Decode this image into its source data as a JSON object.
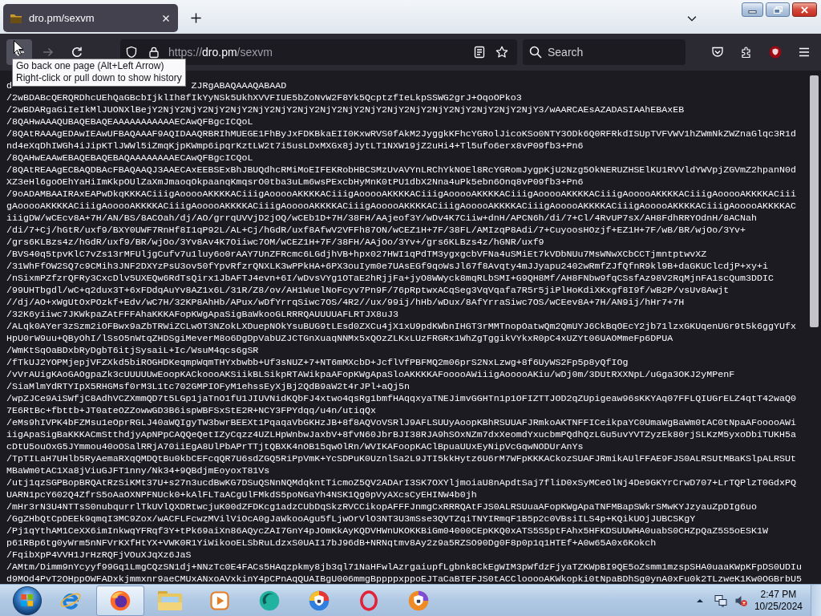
{
  "browser": {
    "tabs": [
      {
        "title": "dro.pm/sexvm",
        "selected": true
      }
    ],
    "navigation": {
      "back": {
        "disabled": false
      },
      "forward": {
        "disabled": true
      }
    },
    "address": {
      "scheme": "https://",
      "host": "dro.pm",
      "path": "/sexvm"
    },
    "search": {
      "placeholder": "Search"
    },
    "tooltip": {
      "lines": [
        "Go back one page (Alt+Left Arrow)",
        "Right-click or pull down to show history"
      ]
    }
  },
  "page": {
    "cut_line": {
      "start": "d",
      "end": "ZJRgABAQAAAQABAAD"
    },
    "lines": [
      "/2wBDABcQERQRDhcUEhQaGBcbIjklIh8fIkYyNSk5UkhXVVFIUE5bZoNvW2F8Yk5QcptzfIeLkpSSWG2grJ+OqoOPko3",
      "/2wBDARgaGiIeIkMlJUONXlBejY2NjY2NjY2NjY2NjY2NjY2NjY2NjY2NjY2NjY2NjY2NjY2NjY2NjY2NjY2NjY2NjY2NjY3/wAARCAEsAZADASIAAhEBAxEB",
      "/8QAHwAAAQUBAQEBAQEAAAAAAAAAAAECAwQFBgcICQoL",
      "/8QAtRAAAgEDAwIEAwUFBAQAAAF9AQIDAAQRBRIhMUEGE1FhByJxFDKBkaEII0KxwRVS0fAkM2JyggkKFhcYGRolJicoKSo0NTY3ODk6Q0RFRkdISUpTVFVWV1hZWmNkZWZnaGlqc3R1d",
      "nd4eXqDhIWGh4iJipKTlJWWl5iZmqKjpKWmp6ipqrKztLW2t7i5usLDxMXGx8jJytLT1NXW19jZ2uHi4+Tl5ufo6erx8vP09fb3+Pn6",
      "/8QAHwEAAwEBAQEBAQEBAQAAAAAAAAECAwQFBgcICQoL",
      "/8QAtREAAgECBAQDBAcFBAQAAQJ3AAECAxEEBSExBhJBUQdhcRMiMoEIFEKRobHBCSMzUvAVYnLRChYkNOEl8RcYGRomJygpKjU2Nzg5OkNERUZHSElKU1RVVldYWVpjZGVmZ2hpanN0d",
      "XZ3eHl6goOEhYaHiImKkpOUlZaXmJmaoqOkpaanqKmqsrO0tba3uLm6wsPExcbHyMnK0tPU1dbX2Nna4uPk5ebn6Onq8vP09fb3+Pn6",
      "/9oADAMBAAIRAxEAPwDkqKKKACiiigAooooAKKKKACiiigAooooAKKKKACiiigAooooAKKKKACiiigAooooAKKKKACiiigAooooAKKKKACiiigAooooAKKKKACiiigAooooAKKKKACiii",
      "gAooooAKKKKACiiigAooooAKKKKACiiigAooooAKKKKACiiigAooooAKKKKACiiigAooooAKKKKACiiigAooooAKKKKACiiigAooooAKKKKACiiigAooooAKKKKACiiigAooooAKKKKAC",
      "iiigDW/wCEcv8A+7H/AN/BS/8ACOah/dj/AO/grrqUVVjD2jOQ/wCEb1D+7H/38FH/AAjeof3Y/wDv4K7Ciiw+dnH/APCN6h/di/7+Cl/4RvUP7sX/AH8FdhRRYOdnH/8ACNah",
      "/di/7+Cj/hGtR/uxf9/BXY0UWF7RnHf8I1qP92L/AL+Cj/hGdR/uxf8AfwV2VFFh87ON/wCEZ1H+7F/38FL/AMIzqP8Adi/7+CuyoosHOzjf+EZ1H+7F/wB/BR/wjOo/3Yv+",
      "/grs6KLBzs4z/hGdR/uxf9/BR/wjOo/3Yv8Av4K7Oiiwc7OM/wCEZ1H+7F/38FH/AAjOo/3Yv+/grs6KLBzs4z/hGNR/uxf9",
      "/BVS40q5tpvKlC7vZs13rMFUljgCufv7u1luy6o0rAAY7UnZFRcmc6LGdjhVB+hpx027HWI1qPdTM3ygxgcbVFNa4uSMiEt7kVDbNUu7MsWNwXCbCCTjmntptwvXZ",
      "/31WhFfOW2SQ7c9CMih3JNF2DXYzPsU3ov50fYpvRfzrQNXLK3wPPkHA+6PX3ouIym0e7UAsEGf9qoWsJl67f8Avqty4mJJyapu2402wRmfZJfQfnR9kl9B+daGKUClcdjP+xy+i",
      "/nSixmPZfzrQFRy3CxcDlv5UXEQw6RdTsQirx1JbAFTJ4evn+6I/wDvsVYg1OTaE2hRjjFa+jyO8WWyck8mqRLbSMI+G9QH8Mf/AH8FNbw9fqCSsfAz98V2RqMjnFA1scQum3DDIC",
      "/99UHTbgdl/wC+q2dux3T+6xFDdqAuYv8AZ1x6L/31R/Z8/ov/AH1WuelNoFcyv7Pn9F/76pRptwxACqSeg3VqVqafa7R5r5jiPlHoKdiXKxgf8I9f/wB2P/vsUv8Awjt",
      "//dj/AO+xWgUtOxPOzkf+Edv/wC7H/32KP8AhHb/APux/wDfYrrqSiwc7OS/4R2//ux/99ij/hHb/wDux/8AfYrraSiwc7OS/wCEev8A+7H/AN9ij/hHr7+7H",
      "/32K6yiiwc7JKWkpaZAtFFFAhaKKKAFopKWgApaSigBaWkooGLRRRQAUUUUAFLRTJX8uJ3",
      "/ALqk0AYer3zSzm2iOFBwx9aZbTRWiZCLwOT3NZokLXDuepNOkYsuBUG9tLEsd0ZXCu4jX1xU9pdKWbnIHGT3rMMTnopOatwQm2QmUYJ6CkBqOEcY2jb71lzxGKUqenUGr9t5k6ggYUfx",
      "HpU0rW9uu+QByOhI/lSsO5nWtqZHDSgiMeverM8o6DgDpVabUZJCTGnXuaqNNMx5xQOzZLKxLUzFRGRx1WhZgTggikVYkxR0pC4xUZYt06UAOMmeFp6DPUA",
      "/WmKtSqOaBDxbRyDgbT6itjSysaiL+Ic/WsuM4qcs6gSR",
      "/fTkUJ2YOPMjepjVFZXkd5biROGHDKeqmpWqmTHYxbwbb+Uf3sNUZ+7+NT6mMXcbD+JcflVfPBFMQ2m06prS2NxLzwg+8f6UyWS2Fp5p8yQfIOg",
      "/vVrAUigKAoGAOgpaZk3cUUUUUwEoopKACkoooAKSiikBLSikpRTAWikpaAFopKWgApaSloAKKKKAFooooAWiiigAooooAKiu/wDj0m/3DUtRXXNpL/uGga3OKJ2yMPenF",
      "/SiaMlmYdRTYIpX5RHGMsf0rM3L1tc702GMPIOFyM1ehssEyXjBj2QdB9aW2t4rJPl+aQj5n",
      "/wpZJCe9AiSWfjC8AdhVCZXmmQD7t5LGp1jaTnO1fU1JIUVNidKQbFJ4xtwo4qsRg1bmfHAqqxyaTNEJimvGGHTn1p1OFIZTTJOD2qZUpigeaw96sKKYAq07FFLQIUGrELZ4qtT42waQ0",
      "7E6RtBc+fbttb+JT0ateOZZowwGD3B6ispWBFSxStE2R+NCY3FPYdqq/u4n/utiqQx",
      "/eMs9hIVPK4bFZMsu1eOprRGLJ40aWQIgyTW3bwrBEEXt1PqaqaVbGKHzJB+8f8AQVoVSRlJ9AFLSUUyAoopKBhRSUUAFJRmkoAKTNFFICeikpaYC0UmaWgBaWm0tAC0tNpaAFooooAWi",
      "iigApaSigBaKKKACmStthdjyApNPpCAQQeQetIZyCqzz4UZLHpWnbwJaxbV+8fvN60JbrBJI38RJA9hSOxNZm7dxXeomdYxucbmPQdhQzLGu5uvYVTZyzEk80rjSLKzM5yxoDbiTUKH5a",
      "cDtU5ouOxG5JYmmou40oOSalRRjA70iiEgA8UlPbAPrTTjtQBXK4nOB15qwOlRn/WVIKAFoopKAClBpuaUUxEyNipVcGqwNODUrAnYs",
      "/TpTILaH7UHlb5RyAemaRXqQMDQtBu0kbCEFcqQR7U6sdZGQ5RiPpVmK+YcSDPuK0UznlSa2L9JTI5kkHytz6U6rM7WFpKKKACkozSUAFJRmikAUlFFAE9FJS0ALRSUtMBaKSlpALRSUt",
      "MBaWm0tAC1Xa8jViuGJFT1nny/Nk34+9QBdjmEoyoxT81Vs",
      "/utj1qzSGPBopBRQAtRzSiKMt37U+s27n3ucdBwKG7DSuQSNnNQMdqkntTicmoZ5QV2ADArI3SK7OXYljmoiaU8nApdtSaj7fliD0xSyMCeOlNj4De9GKYrCrwD707+LrTQPlzT0GdxPQ",
      "UARN1pcY602Q4ZfrS5oAaOXNPFNUck0+kAlFLTaACgUlFMkdS5poNGaYh4NSK1Qg0pVyAXcsCyEHINW4b0jh",
      "/mHr3rN3U4NTTsS0nubqurrlTkUVlQXDRtwcjuK00dZFDKcg1adzCUbDqSkzRVCCikopAFFFJnmgCxRRRQAtFJS0ALRSUuaAFopKWgApaTNFMBapSWkrSMwKYJzyauZpDIg6uo",
      "/GgZHbQtCpDEEk9qmqI3MC9Zox/wACFLFcwzMVilViOcA0gJaWkooAgu5fLjwOrVlO3NT3U3mSse3QVTZqiTNYIRmqF1B5p2c0VBsiILS4p+KQikUOjJUBCSKgY",
      "/Pj1qYthAM1CeXX6imInkwqYFRqf3Y+tPk69aiXn86AQycZAI7GnY4pJOmKkAyKQDVHWnUKOKKBiGm04000CEpKKQ0xATS5S5ptFAhx5HFKDSUUWHA0uabS0CHZpQaZ5S5oESK1W",
      "p61RBp6tg0yWrm5nNFVrKXfHtYX+VWK0R1YiWikooELSbRuLdzxS0UAI17bJ96dB+NRNqtmv8Ay2z9a5RZSO90Dg0F8p0p1q1HTEf+A0w65A0x6Kokch",
      "/FqibXpP4VVH1JrHzRQFjVOuXJqXz6JaS",
      "/AMtm/Dimm9nYcyyf99Gq1LmgCQzSN1dj+NNzTc0E4FACs5HAqzpkmy8jb3ql71NaHFwlAzrgaiupfLgbnk8CkEgWIM3pWfdzFjyaTZKWpBI9QE5oZsmm1mzspSHA0uaaKWpKFpDS0UDIu",
      "d9MOd4PvT2OHppOWFADxkjmmxnr9aeCMUxANxoAVxkinY4pCPnAqQUAIBgU006mmgBppppxppoEJTaCaBTEFJS0tACClooooAKWkopki0tNpaBDhSg0ynA0xFu0k2TLzweK1Kw0OGBrbU5"
    ]
  },
  "taskbar": {
    "apps": [
      {
        "kind": "ie",
        "selected": false
      },
      {
        "kind": "firefox",
        "selected": true
      },
      {
        "kind": "folder",
        "selected": false
      },
      {
        "kind": "player",
        "selected": false
      },
      {
        "kind": "bubble",
        "selected": false
      },
      {
        "kind": "lockblue",
        "selected": false
      },
      {
        "kind": "opera",
        "selected": false
      },
      {
        "kind": "lockorange",
        "selected": false
      }
    ],
    "tray": {
      "volume_muted": true
    },
    "clock": {
      "time": "2:47 PM",
      "date": "10/25/2024"
    }
  }
}
